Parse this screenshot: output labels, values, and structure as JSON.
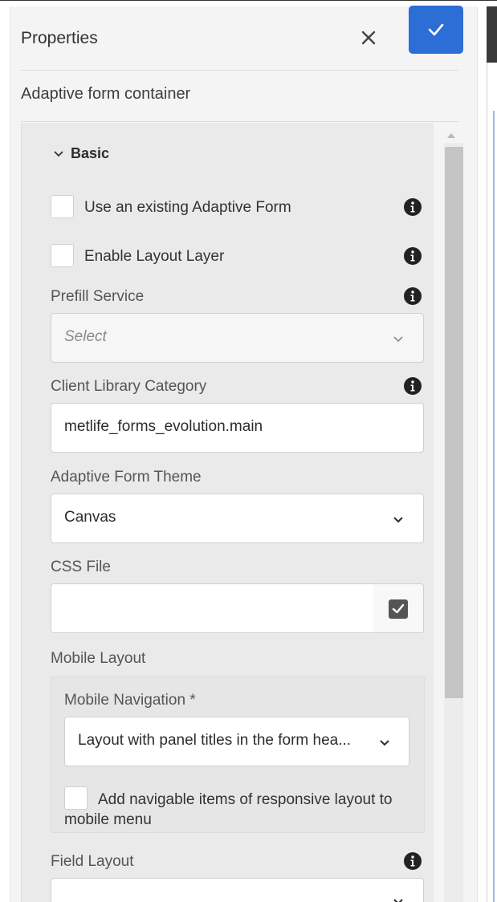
{
  "header": {
    "title": "Properties",
    "close_icon": "close-icon",
    "confirm_icon": "checkmark-icon",
    "accent_color": "#2d6dd6"
  },
  "component_name": "Adaptive form container",
  "section": {
    "label": "Basic",
    "icon": "chevron-down-icon"
  },
  "fields": {
    "use_existing_form": {
      "label": "Use an existing Adaptive Form",
      "checked": false
    },
    "enable_layout_layer": {
      "label": "Enable Layout Layer",
      "checked": false
    },
    "prefill_service": {
      "label": "Prefill Service",
      "placeholder": "Select"
    },
    "client_library_category": {
      "label": "Client Library Category",
      "value": "metlife_forms_evolution.main"
    },
    "adaptive_form_theme": {
      "label": "Adaptive Form Theme",
      "value": "Canvas"
    },
    "css_file": {
      "label": "CSS File",
      "value": ""
    },
    "mobile_layout": {
      "label": "Mobile Layout",
      "mobile_navigation_label": "Mobile Navigation *",
      "mobile_navigation_value": "Layout with panel titles in the form hea...",
      "add_navigable_label_line1": "Add navigable items of responsive layout to",
      "add_navigable_label_line2": "mobile menu",
      "add_navigable_checked": false
    },
    "field_layout": {
      "label": "Field Layout"
    }
  }
}
